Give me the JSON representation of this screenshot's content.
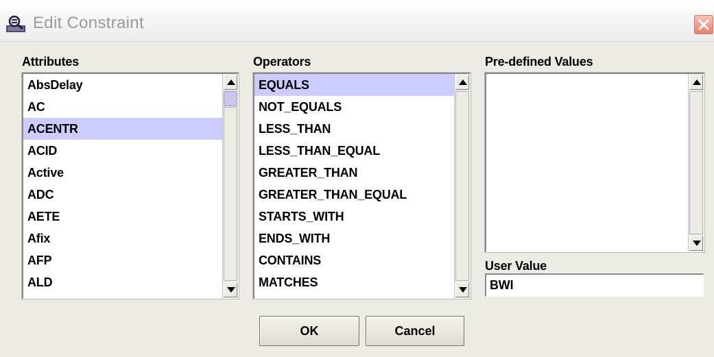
{
  "window": {
    "title": "Edit Constraint",
    "icon": "magnifier-app-icon",
    "close_icon": "close-icon"
  },
  "attributes": {
    "label": "Attributes",
    "items": [
      "AbsDelay",
      "AC",
      "ACENTR",
      "ACID",
      "Active",
      "ADC",
      "AETE",
      "Afix",
      "AFP",
      "ALD"
    ],
    "selected": "ACENTR"
  },
  "operators": {
    "label": "Operators",
    "items": [
      "EQUALS",
      "NOT_EQUALS",
      "LESS_THAN",
      "LESS_THAN_EQUAL",
      "GREATER_THAN",
      "GREATER_THAN_EQUAL",
      "STARTS_WITH",
      "ENDS_WITH",
      "CONTAINS",
      "MATCHES"
    ],
    "selected": "EQUALS"
  },
  "predefined_values": {
    "label": "Pre-defined Values",
    "items": []
  },
  "user_value": {
    "label": "User Value",
    "value": "BWI"
  },
  "buttons": {
    "ok": "OK",
    "cancel": "Cancel"
  },
  "colors": {
    "selection": "#ccccff",
    "background": "#ecebe4"
  }
}
